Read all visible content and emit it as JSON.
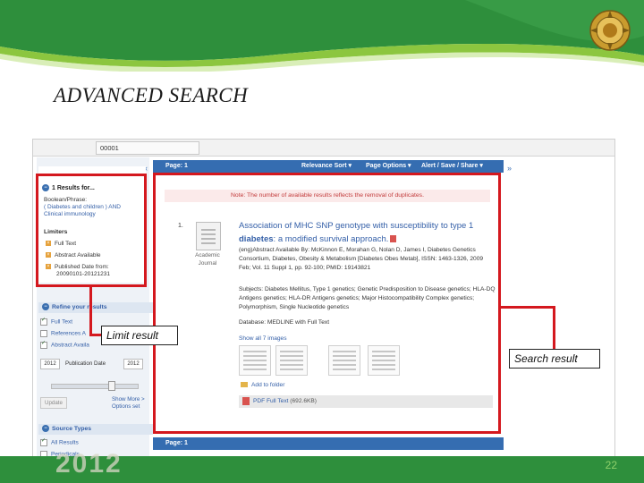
{
  "slide": {
    "title": "ADVANCED SEARCH",
    "year": "2012",
    "page_number": "22",
    "colors": {
      "banner_green": "#2e8f3c",
      "highlight_red": "#d4181e",
      "link_blue": "#3560a8"
    }
  },
  "browser": {
    "address_value": "00001"
  },
  "left_panel": {
    "collapse_icon": "«",
    "results_heading": "1 Results for...",
    "boolean_label": "Boolean/Phrase:",
    "query": "( Diabetes and children ) AND Clinical immunology",
    "limiters_heading": "Limiters",
    "limiters": [
      "Full Text",
      "Abstract Available",
      "Published Date from:"
    ],
    "date_range": "20090101-20121231",
    "refine_heading": "Refine your results",
    "refine_options": [
      "Full Text",
      "References A",
      "Abstract Availa"
    ],
    "pub_from": "2012",
    "pub_label": "Publication Date",
    "pub_to": "2012",
    "update_label": "Update",
    "show_more": "Show More >",
    "options_set": "Options set",
    "source_types_heading": "Source Types",
    "source_options": [
      "All Results",
      "Periodicals"
    ]
  },
  "results_bar": {
    "page_label": "Page: 1",
    "relevance_sort": "Relevance Sort ▾",
    "page_options": "Page Options ▾",
    "alert_save_share": "Alert / Save / Share ▾",
    "expand_icon": "»"
  },
  "note": "Note: The number of available results reflects the removal of duplicates.",
  "result": {
    "number": "1.",
    "doc_type": "Academic Journal",
    "title_pre": "Association of MHC SNP genotype with susceptibility to type 1 ",
    "title_bold": "diabetes",
    "title_post": ": a modified survival approach.",
    "abstract": "(eng)Abstract Available By: McKinnon E, Morahan G, Nolan D, James I, Diabetes Genetics Consortium, Diabetes, Obesity & Metabolism [Diabetes Obes Metab], ISSN: 1463-1326, 2009 Feb; Vol. 11 Suppl 1, pp. 92-100; PMID: 19143821",
    "subjects": "Subjects: Diabetes Mellitus, Type 1 genetics; Genetic Predisposition to Disease genetics; HLA-DQ Antigens genetics; HLA-DR Antigens genetics; Major Histocompatibility Complex genetics; Polymorphism, Single Nucleotide genetics",
    "database": "Database: MEDLINE with Full Text",
    "show_images": "Show all 7 images",
    "add_folder": "Add to folder",
    "pdf_label": "PDF Full Text",
    "pdf_size": "(692.6KB)"
  },
  "footer_bar": {
    "page_label": "Page: 1"
  },
  "callouts": {
    "limit": "Limit result",
    "search": "Search result"
  }
}
